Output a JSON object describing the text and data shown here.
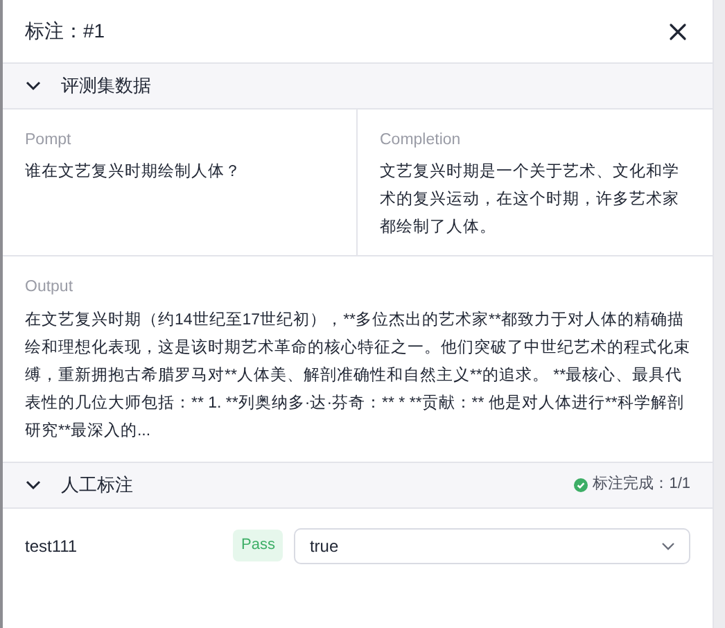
{
  "drawer": {
    "title": "标注：#1"
  },
  "sections": [
    {
      "title": "评测集数据",
      "expanded": true,
      "kind": "dataset",
      "fields": [
        {
          "label": "Pompt",
          "value": "谁在文艺复兴时期绘制人体？"
        },
        {
          "label": "Completion",
          "value": "文艺复兴时期是一个关于艺术、文化和学术的复兴运动，在这个时期，许多艺术家都绘制了人体。"
        },
        {
          "label": "Output",
          "value": "在文艺复兴时期（约14世纪至17世纪初），**多位杰出的艺术家**都致力于对人体的精确描绘和理想化表现，这是该时期艺术革命的核心特征之一。他们突破了中世纪艺术的程式化束缚，重新拥抱古希腊罗马对**人体美、解剖准确性和自然主义**的追求。 **最核心、最具代表性的几位大师包括：** 1. **列奥纳多·达·芬奇：** * **贡献：** 他是对人体进行**科学解剖研究**最深入的..."
        }
      ]
    },
    {
      "title": "人工标注",
      "expanded": true,
      "kind": "annotation",
      "status": "标注完成：1/1",
      "rows": [
        {
          "name": "test111",
          "tag": "Pass",
          "value": "true"
        }
      ]
    }
  ]
}
